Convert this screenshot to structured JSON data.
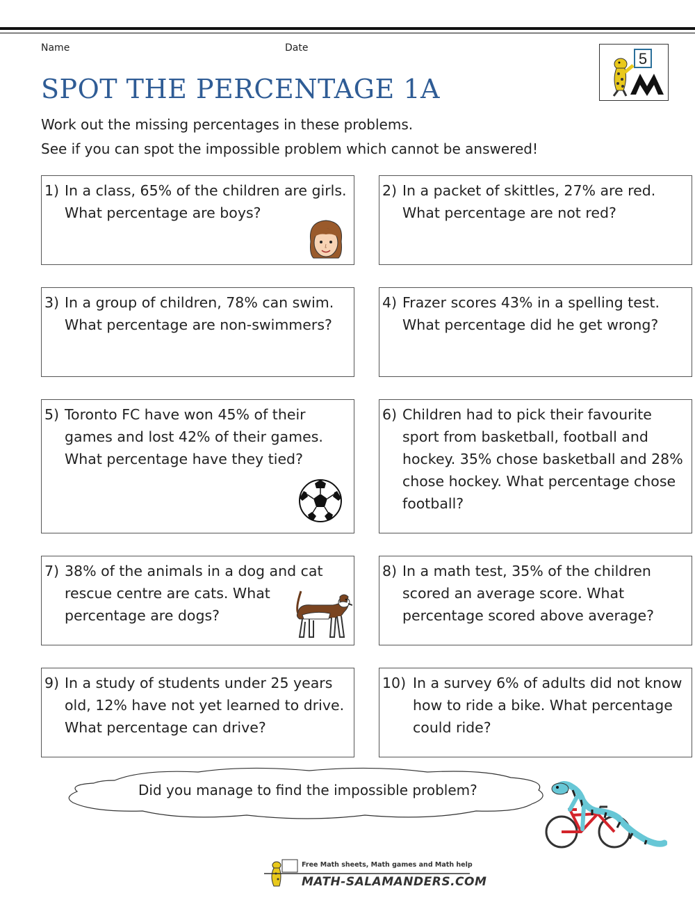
{
  "header": {
    "name_label": "Name",
    "date_label": "Date",
    "title": "SPOT THE PERCENTAGE 1A",
    "intro_line1": "Work out the missing percentages in these problems.",
    "intro_line2": "See if you can spot the impossible problem which cannot be answered!",
    "grade_badge": "5"
  },
  "questions": [
    {
      "num": "1)",
      "text": "In a class, 65% of the children are girls. What percentage are boys?"
    },
    {
      "num": "2)",
      "text": "In a packet of skittles, 27% are red. What percentage are not red?"
    },
    {
      "num": "3)",
      "text": "In a group of children, 78% can swim. What percentage are non-swimmers?"
    },
    {
      "num": "4)",
      "text": "Frazer scores 43% in a spelling test. What percentage did he get wrong?"
    },
    {
      "num": "5)",
      "text": "Toronto FC have won 45% of their games and lost 42% of their games. What percentage have they tied?"
    },
    {
      "num": "6)",
      "text": "Children had to pick their favourite sport from basketball, football and hockey. 35% chose basketball and 28% chose hockey. What percentage chose football?"
    },
    {
      "num": "7)",
      "text": "38% of the animals in a dog and cat rescue centre are cats. What percentage are dogs?"
    },
    {
      "num": "8)",
      "text": "In a math test, 35% of the children scored an average score. What percentage scored above average?"
    },
    {
      "num": "9)",
      "text": "In a study of students under 25 years old, 12% have not yet learned to drive. What percentage can drive?"
    },
    {
      "num": "10)",
      "text": "In a survey 6% of adults did not know how to ride a bike. What percentage could ride?"
    }
  ],
  "footer": {
    "cloud_text": "Did you manage to find the impossible problem?",
    "tagline": "Free Math sheets, Math games and Math help",
    "site": "MATH-SALAMANDERS.COM"
  },
  "colors": {
    "title": "#2f5c95",
    "salamander_yellow": "#e9c91c",
    "salamander_cyan": "#67c7d6",
    "bike_red": "#d3242b"
  }
}
